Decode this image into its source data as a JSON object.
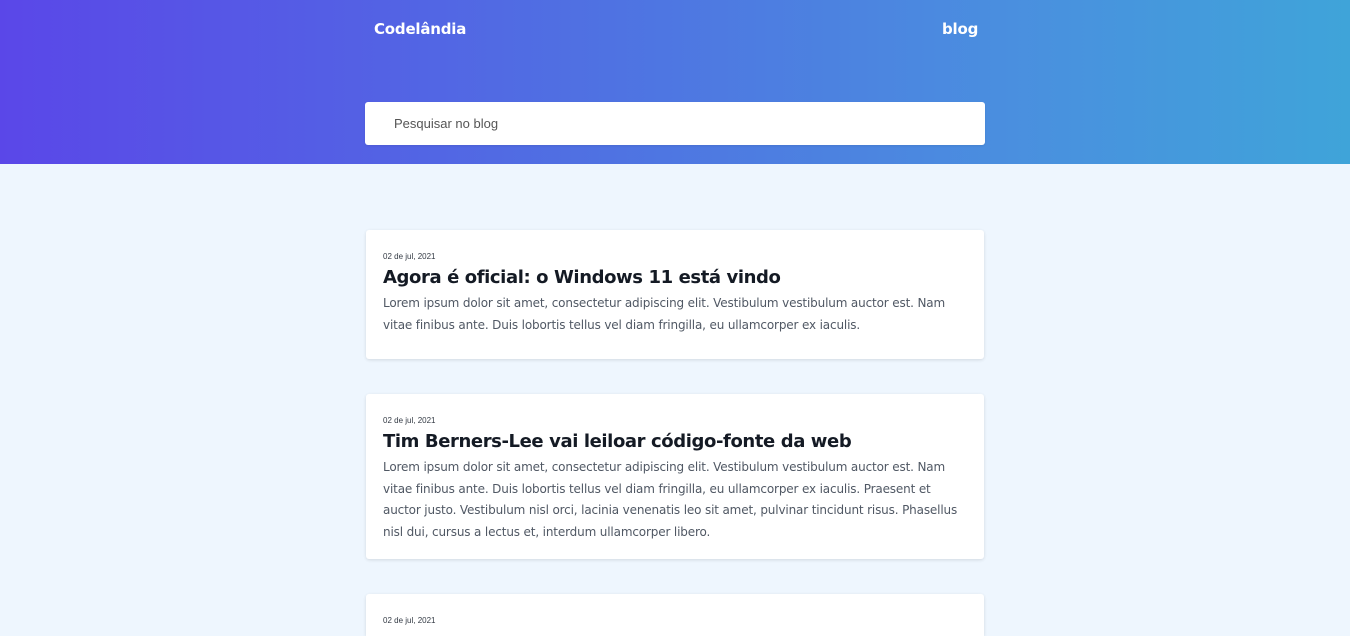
{
  "header": {
    "brand": "Codelândia",
    "nav_blog": "blog",
    "search_placeholder": "Pesquisar no blog"
  },
  "posts": [
    {
      "date": "02 de jul, 2021",
      "title": "Agora é oficial: o Windows 11 está vindo",
      "excerpt": "Lorem ipsum dolor sit amet, consectetur adipiscing elit. Vestibulum vestibulum auctor est. Nam vitae finibus ante. Duis lobortis tellus vel diam fringilla, eu ullamcorper ex iaculis."
    },
    {
      "date": "02 de jul, 2021",
      "title": "Tim Berners-Lee vai leiloar código-fonte da web",
      "excerpt": "Lorem ipsum dolor sit amet, consectetur adipiscing elit. Vestibulum vestibulum auctor est. Nam vitae finibus ante. Duis lobortis tellus vel diam fringilla, eu ullamcorper ex iaculis. Praesent et auctor justo. Vestibulum nisl orci, lacinia venenatis leo sit amet, pulvinar tincidunt risus. Phasellus nisl dui, cursus a lectus et, interdum ullamcorper libero."
    },
    {
      "date": "02 de jul, 2021",
      "title": "",
      "excerpt": ""
    }
  ],
  "colors": {
    "gradient_start": "#5a47e8",
    "gradient_end": "#3fa4d9",
    "page_background": "#eef6fe",
    "card_background": "#ffffff",
    "title_text": "#141a24",
    "body_text": "#505864"
  }
}
